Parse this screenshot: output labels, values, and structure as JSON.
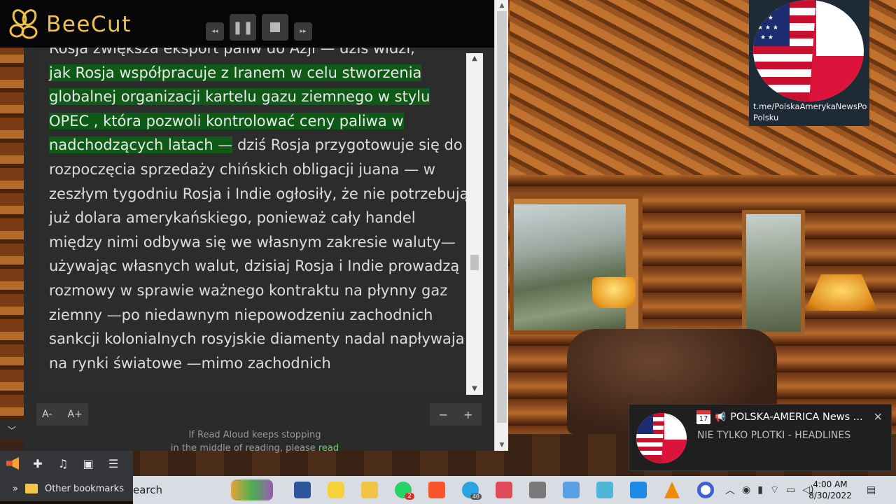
{
  "app": {
    "name": "BeeCut"
  },
  "reader": {
    "paragraph": {
      "line_top": "Rosja zwiększa eksport paliw do Azji — dziś widzi,",
      "highlight_1": "jak Rosja współpracuje z Iranem w celu stworzenia",
      "highlight_2": "globalnej organizacji kartelu gazu ziemnego w stylu",
      "highlight_3": "OPEC , która pozwoli kontrolować ceny paliwa w",
      "highlight_4": "nadchodzących latach —",
      "rest": " dziś Rosja przygotowuje się do rozpoczęcia sprzedaży chińskich obligacji juana — w zeszłym tygodniu Rosja i Indie ogłosiły, że nie potrzebują już dolara amerykańskiego, ponieważ cały handel między nimi odbywa się we własnym zakresie waluty—używając własnych walut, dzisiaj Rosja i Indie prowadzą rozmowy w sprawie ważnego kontraktu na płynny gaz ziemny —po niedawnym niepowodzeniu zachodnich sankcji kolonialnych rosyjskie diamenty nadal napływaja na rynki światowe —mimo zachodnich"
    },
    "font_decrease": "A-",
    "font_increase": "A+",
    "speed_decrease": "−",
    "speed_increase": "+",
    "notice_line1": "If Read Aloud keeps stopping",
    "notice_line2_prefix": "in the middle of reading, please ",
    "notice_line2_link": "read"
  },
  "channel": {
    "url": "t.me/PolskaAmerykaNewsPoPolsku"
  },
  "notification": {
    "title": "POLSKA-AMERICA News ...",
    "body": "NIE TYLKO PLOTKI - HEADLINES",
    "calendar_day": "17"
  },
  "browser": {
    "bookmarks_label": "Other bookmarks",
    "chevron": "»"
  },
  "taskbar": {
    "search_label": "earch",
    "whatsapp_badge": "2",
    "telegram_badge": "40",
    "time": "4:00 AM",
    "date": "8/30/2022"
  },
  "colors": {
    "highlight": "#0e5a16",
    "brand_yellow": "#f0c24a",
    "link_green": "#6fcf6f"
  }
}
